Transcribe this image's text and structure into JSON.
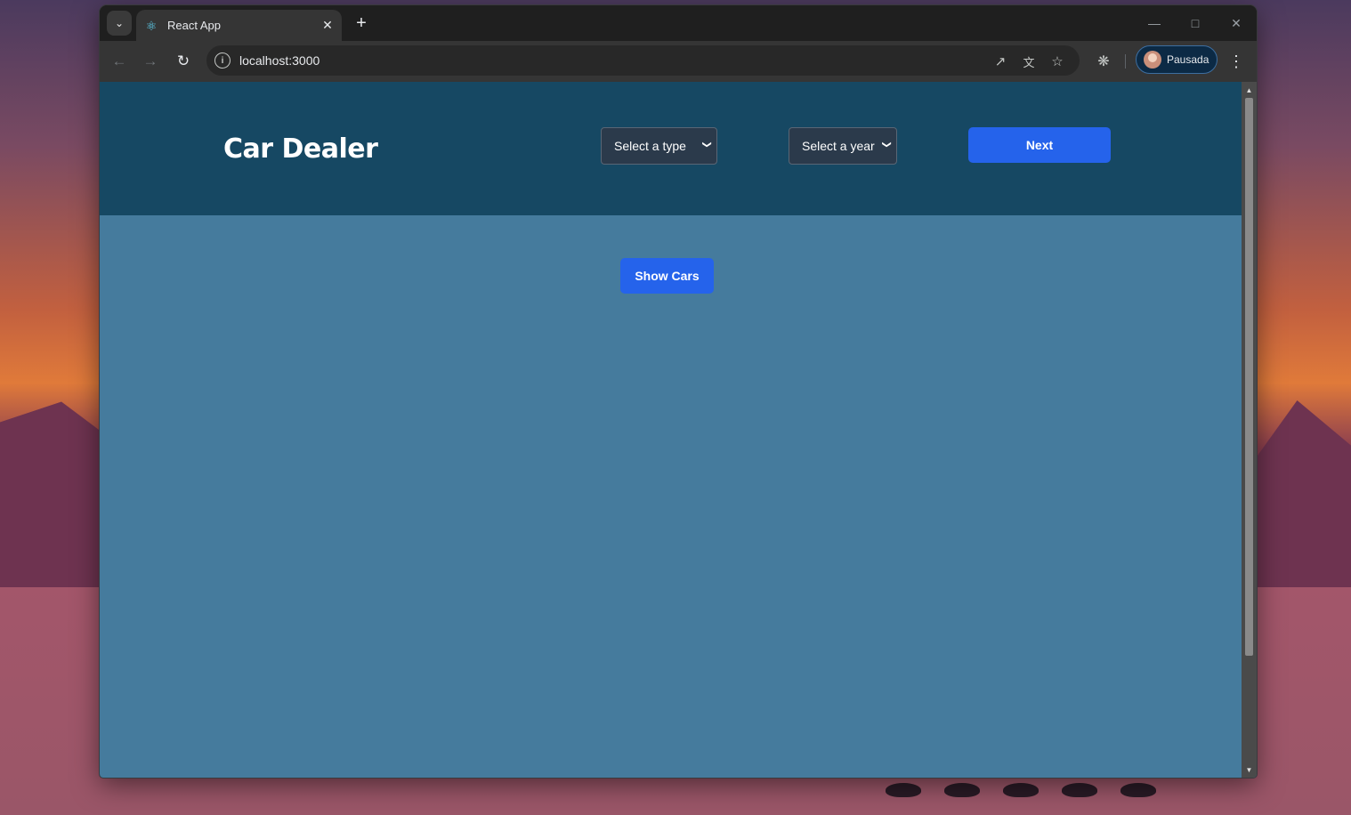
{
  "browser": {
    "tab": {
      "title": "React App",
      "favicon": "react-icon"
    },
    "url": "localhost:3000",
    "profile": {
      "name": "Pausada"
    }
  },
  "page": {
    "brand": "Car Dealer",
    "type_select": {
      "selected": "Select a type"
    },
    "year_select": {
      "selected": "Select a year"
    },
    "next_button": "Next",
    "show_cars_button": "Show Cars"
  },
  "colors": {
    "header_bg": "#164863",
    "content_bg": "#457b9d",
    "primary_button": "#2563eb"
  }
}
